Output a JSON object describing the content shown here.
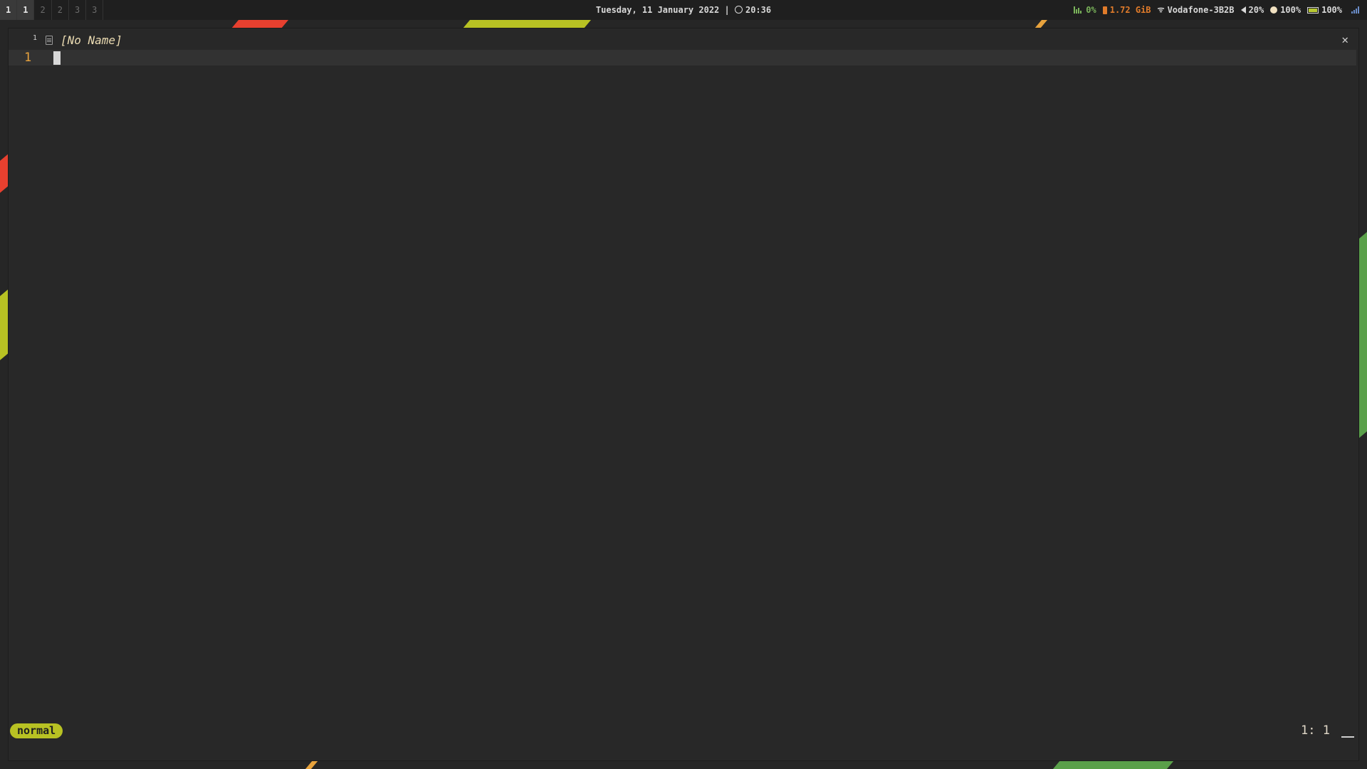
{
  "topbar": {
    "workspaces": [
      {
        "label": "1",
        "active": true
      },
      {
        "label": "1",
        "active": true
      },
      {
        "label": "2",
        "active": false
      },
      {
        "label": "2",
        "active": false
      },
      {
        "label": "3",
        "active": false
      },
      {
        "label": "3",
        "active": false
      }
    ],
    "datetime": "Tuesday, 11 January 2022 | ",
    "clock_icon": "clock-icon",
    "time": "20:36",
    "status": {
      "cpu": "0%",
      "memory": "1.72 GiB",
      "wifi": "Vodafone-3B2B",
      "volume": "20%",
      "brightness": "100%",
      "battery": "100%"
    },
    "colors": {
      "cpu": "#7ab35a",
      "memory": "#e07b2a",
      "battery": "#b8c832"
    }
  },
  "editor": {
    "tab": {
      "number": "1",
      "name": "[No Name]"
    },
    "close_glyph": "✕",
    "line_numbers": [
      "1"
    ],
    "mode": "normal",
    "position": "1: 1",
    "colors": {
      "mode_bg": "#b8c223",
      "line_number": "#e8a33d"
    }
  }
}
